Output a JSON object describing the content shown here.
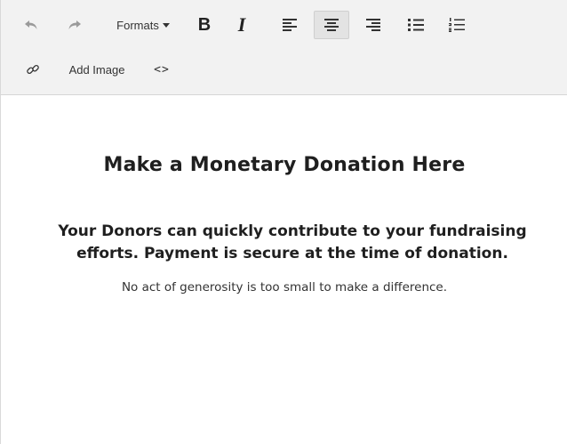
{
  "toolbar": {
    "formats_label": "Formats",
    "add_image_label": "Add Image",
    "code_label": "<>",
    "bold_label": "B",
    "italic_label": "I",
    "align_center_active": true,
    "icons": [
      "undo-icon",
      "redo-icon",
      "caret-down-icon",
      "bold-icon",
      "italic-icon",
      "align-left-icon",
      "align-center-icon",
      "align-right-icon",
      "bullet-list-icon",
      "numbered-list-icon",
      "link-icon",
      "code-icon"
    ]
  },
  "content": {
    "heading": "Make a Monetary Donation Here",
    "subhead": "Your Donors can quickly contribute to your fundraising efforts. Payment is secure at the time of donation.",
    "note": "No act of generosity is too small to make a difference."
  }
}
